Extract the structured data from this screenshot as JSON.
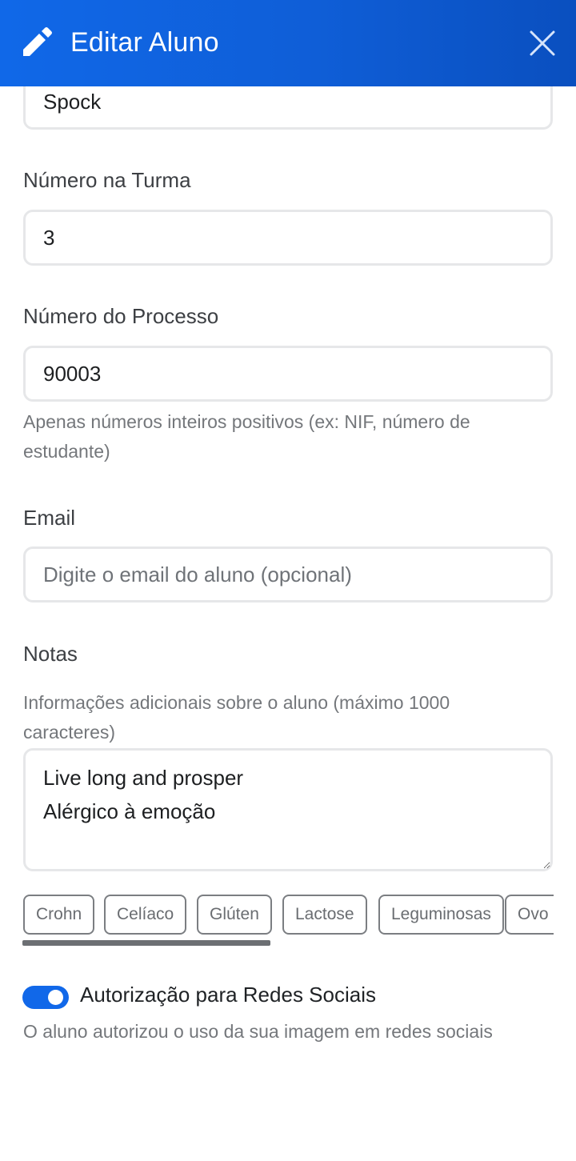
{
  "header": {
    "title": "Editar Aluno",
    "icon": "pencil-icon",
    "close_icon": "close-icon",
    "background": "#1068e8"
  },
  "form": {
    "name": {
      "value": "Spock"
    },
    "class_number": {
      "label": "Número na Turma",
      "value": "3"
    },
    "process_number": {
      "label": "Número do Processo",
      "value": "90003",
      "help": "Apenas números inteiros positivos (ex: NIF, número de estudante)"
    },
    "email": {
      "label": "Email",
      "value": "",
      "placeholder": "Digite o email do aluno (opcional)"
    },
    "notes": {
      "label": "Notas",
      "help": "Informações adicionais sobre o aluno (máximo 1000 caracteres)",
      "value": "Live long and prosper\nAlérgico à emoção"
    },
    "tags": [
      "Crohn",
      "Celíaco",
      "Glúten",
      "Lactose",
      "Leguminosas",
      "Ovo"
    ],
    "social_media": {
      "label": "Autorização para Redes Sociais",
      "help": "O aluno autorizou o uso da sua imagem em redes sociais",
      "enabled": true,
      "accent": "#1168e9"
    }
  }
}
